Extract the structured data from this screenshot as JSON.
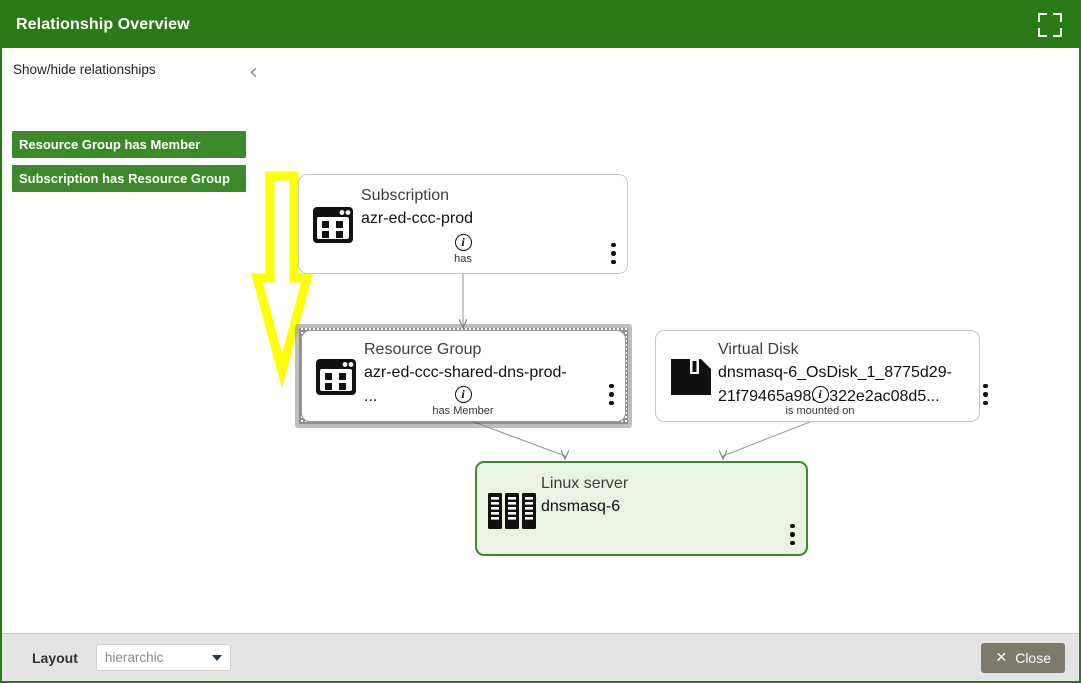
{
  "window": {
    "title": "Relationship Overview",
    "fullscreen_icon": "fullscreen-expand-icon"
  },
  "legend": {
    "title": "Show/hide relationships",
    "collapse_icon": "chevron-left-icon",
    "items": [
      {
        "label": "Resource Group has Member",
        "color": "#3b8a2a"
      },
      {
        "label": "Subscription has Resource Group",
        "color": "#3b8a2a"
      }
    ]
  },
  "graph": {
    "nodes": [
      {
        "id": "subscription",
        "type": "Subscription",
        "label": "azr-ed-ccc-prod",
        "icon": "window-grid-icon",
        "selected": false,
        "highlight": false,
        "menu_icon": "kebab-menu-icon"
      },
      {
        "id": "resource-group",
        "type": "Resource Group",
        "label": "azr-ed-ccc-shared-dns-prod-",
        "label_line2": "...",
        "icon": "window-grid-icon",
        "selected": true,
        "highlight": false,
        "menu_icon": "kebab-menu-icon"
      },
      {
        "id": "virtual-disk",
        "type": "Virtual Disk",
        "label": "dnsmasq-6_OsDisk_1_8775d29-",
        "label_line2": "21f79465a989e322e2ac08d5...",
        "icon": "floppy-disk-icon",
        "selected": false,
        "highlight": false,
        "menu_icon": "kebab-menu-icon"
      },
      {
        "id": "linux-server",
        "type": "Linux server",
        "label": "dnsmasq-6",
        "icon": "server-rack-icon",
        "selected": false,
        "highlight": true,
        "menu_icon": "kebab-menu-icon"
      }
    ],
    "edges": [
      {
        "id": "edge-has",
        "label": "has",
        "info_icon": "info-circle-icon",
        "from": "subscription",
        "to": "resource-group"
      },
      {
        "id": "edge-has-member",
        "label": "has Member",
        "info_icon": "info-circle-icon",
        "from": "resource-group",
        "to": "linux-server"
      },
      {
        "id": "edge-is-mounted-on",
        "label": "is mounted on",
        "info_icon": "info-circle-icon",
        "from": "virtual-disk",
        "to": "linux-server"
      }
    ],
    "annotation": {
      "shape": "down-arrow",
      "color": "#ffff00"
    }
  },
  "toolbar": {
    "layout_label": "Layout",
    "layout_value": "hierarchic",
    "caret_icon": "caret-down-icon",
    "close_label": "Close",
    "close_icon": "close-x-icon"
  },
  "colors": {
    "header_green": "#2a7a17",
    "legend_green": "#3b8a2a",
    "highlight_fill": "#e9f2e3",
    "highlight_border": "#3a8b22",
    "close_button": "#7d7a6b",
    "toolbar_bg": "#e4e4e4",
    "annotation_yellow": "#ffff00"
  }
}
